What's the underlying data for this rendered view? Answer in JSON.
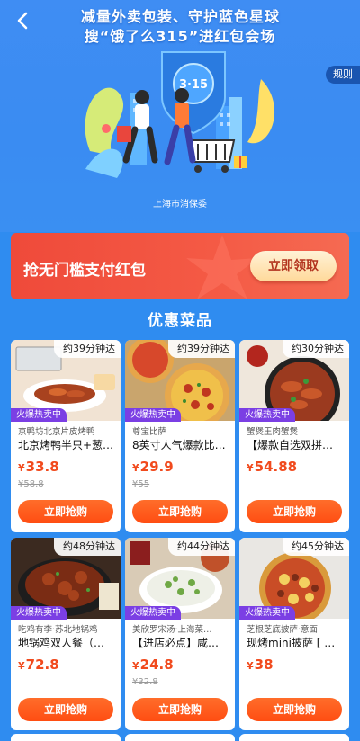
{
  "hero": {
    "headline_line1": "减量外卖包装、守护蓝色星球",
    "headline_line2": "搜“饿了么315”进红包会场",
    "rules_label": "规则",
    "org_label": "上海市消保委",
    "badge_text": "3·15"
  },
  "banner": {
    "title": "抢无门槛支付红包",
    "button_label": "立即领取"
  },
  "section_title": "优惠菜品",
  "products": [
    {
      "eta": "约39分钟达",
      "tag": "火爆热卖中",
      "shop": "京鸭坊北京片皮烤鸭",
      "dish": "北京烤鸭半只+葱…",
      "price": "33.8",
      "original_price": "¥58.8",
      "button": "立即抢购",
      "image": "roast-duck"
    },
    {
      "eta": "约39分钟达",
      "tag": "火爆热卖中",
      "shop": "尊宝比萨",
      "dish": "8英寸人气爆款比…",
      "price": "29.9",
      "original_price": "¥55",
      "button": "立即抢购",
      "image": "pizza"
    },
    {
      "eta": "约30分钟达",
      "tag": "火爆热卖中",
      "shop": "蟹煲王肉蟹煲",
      "dish": "【爆款自选双拼…",
      "price": "54.88",
      "original_price": "",
      "button": "立即抢购",
      "image": "crab-pot"
    },
    {
      "eta": "约48分钟达",
      "tag": "火爆热卖中",
      "shop": "吃鸡有李·苏北地锅鸡",
      "dish": "地锅鸡双人餐（…",
      "price": "72.8",
      "original_price": "",
      "button": "立即抢购",
      "image": "chicken-pot"
    },
    {
      "eta": "约44分钟达",
      "tag": "火爆热卖中",
      "shop": "美欣罗宋汤·上海菜…",
      "dish": "【进店必点】咸…",
      "price": "24.8",
      "original_price": "¥32.8",
      "button": "立即抢购",
      "image": "veg-rice"
    },
    {
      "eta": "约45分钟达",
      "tag": "火爆热卖中",
      "shop": "芝根芝底披萨·意面",
      "dish": "现烤mini披萨 [ …",
      "price": "38",
      "original_price": "",
      "button": "立即抢购",
      "image": "mini-pizza"
    }
  ],
  "currency_symbol": "¥",
  "colors": {
    "background": "#2f8cf0",
    "banner_red": "#ef4a3a",
    "price_red": "#f14a1d",
    "button_orange": "#ff5a1a",
    "tag_purple": "#7b3fe4"
  }
}
